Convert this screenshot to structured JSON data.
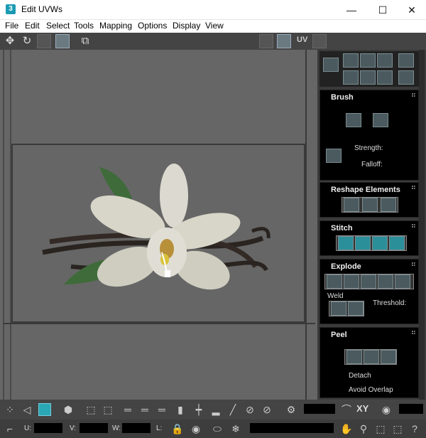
{
  "window": {
    "title": "Edit UVWs",
    "app_icon": "3",
    "minimize": "—",
    "maximize": "☐",
    "close": "✕"
  },
  "menu": [
    "File",
    "Edit",
    "Select",
    "Tools",
    "Mapping",
    "Options",
    "Display",
    "View"
  ],
  "toolbar": {
    "uv_label": "UV"
  },
  "rollouts": {
    "brush": {
      "title": "Brush",
      "strength_label": "Strength:",
      "falloff_label": "Falloff:"
    },
    "reshape": {
      "title": "Reshape Elements"
    },
    "stitch": {
      "title": "Stitch"
    },
    "explode": {
      "title": "Explode",
      "weld_label": "Weld",
      "threshold_label": "Threshold:"
    },
    "peel": {
      "title": "Peel",
      "detach_label": "Detach",
      "avoid_overlap_label": "Avoid Overlap"
    }
  },
  "bottom": {
    "xy_label": "XY",
    "u_label": "U:",
    "v_label": "V:",
    "w_label": "W:",
    "l_label": "L:"
  },
  "colors": {
    "accent": "#2aa6b4",
    "panel": "#000000",
    "viewport": "#666666"
  }
}
